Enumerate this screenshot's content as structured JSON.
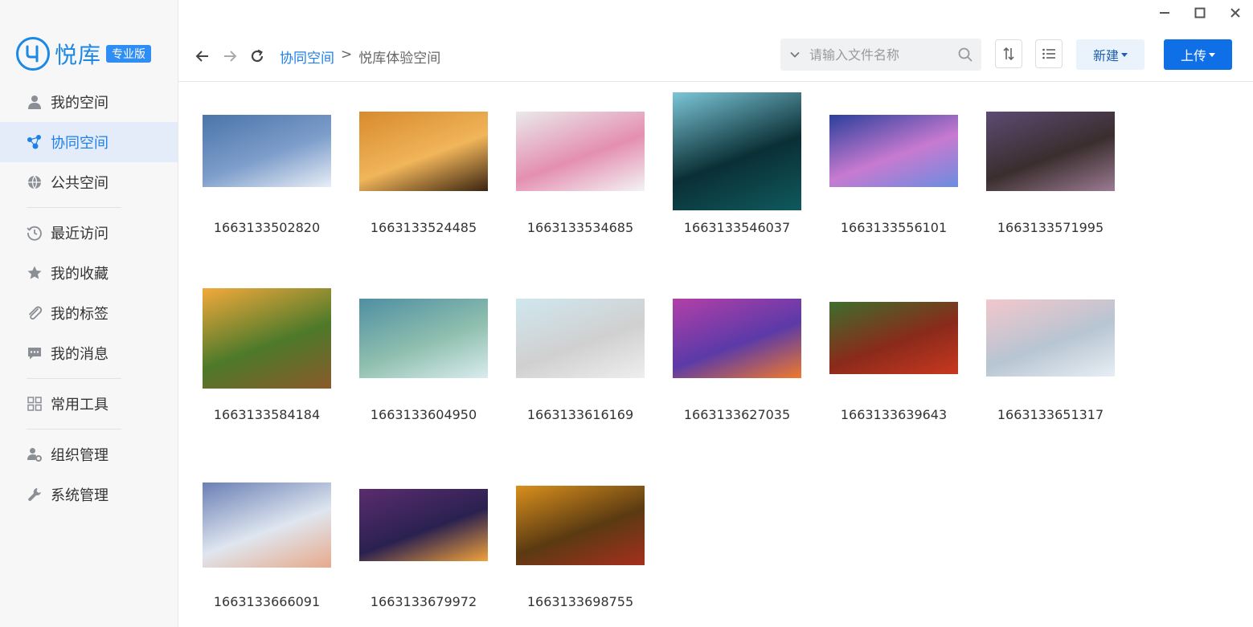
{
  "app": {
    "logo_text": "悦库",
    "logo_badge": "专业版"
  },
  "sidebar": {
    "items": [
      {
        "label": "我的空间",
        "icon": "user-icon",
        "active": false
      },
      {
        "label": "协同空间",
        "icon": "collaboration-icon",
        "active": true
      },
      {
        "label": "公共空间",
        "icon": "globe-icon",
        "active": false
      },
      {
        "label": "最近访问",
        "icon": "history-icon",
        "active": false
      },
      {
        "label": "我的收藏",
        "icon": "star-icon",
        "active": false
      },
      {
        "label": "我的标签",
        "icon": "paperclip-icon",
        "active": false
      },
      {
        "label": "我的消息",
        "icon": "message-icon",
        "active": false
      },
      {
        "label": "常用工具",
        "icon": "grid-icon",
        "active": false
      },
      {
        "label": "组织管理",
        "icon": "org-user-gear-icon",
        "active": false
      },
      {
        "label": "系统管理",
        "icon": "wrench-icon",
        "active": false
      }
    ]
  },
  "toolbar": {
    "breadcrumb_root": "协同空间",
    "breadcrumb_sep": ">",
    "breadcrumb_current": "悦库体验空间",
    "search_placeholder": "请输入文件名称",
    "new_label": "新建",
    "upload_label": "上传"
  },
  "files": [
    {
      "name": "1663133502820",
      "aspect": 0.5625,
      "colors": [
        "#4a74a8",
        "#e8eef6",
        "#7e9ecb"
      ]
    },
    {
      "name": "1663133524485",
      "aspect": 0.62,
      "colors": [
        "#d88a2e",
        "#3a2410",
        "#f1b55a"
      ]
    },
    {
      "name": "1663133534685",
      "aspect": 0.62,
      "colors": [
        "#e9e9eb",
        "#f3f3f4",
        "#e48fb0"
      ]
    },
    {
      "name": "1663133546037",
      "aspect": 0.92,
      "colors": [
        "#7cc6d8",
        "#0f5a5e",
        "#0a2f35"
      ]
    },
    {
      "name": "1663133556101",
      "aspect": 0.56,
      "colors": [
        "#2a3f9b",
        "#6b8de0",
        "#c77ad0"
      ]
    },
    {
      "name": "1663133571995",
      "aspect": 0.62,
      "colors": [
        "#5e4a73",
        "#9c7b93",
        "#3a2e2e"
      ]
    },
    {
      "name": "1663133584184",
      "aspect": 0.78,
      "colors": [
        "#f3a93c",
        "#8a5a2a",
        "#4d7a2a"
      ]
    },
    {
      "name": "1663133604950",
      "aspect": 0.62,
      "colors": [
        "#4f8fa3",
        "#d9ecee",
        "#8fbfae"
      ]
    },
    {
      "name": "1663133616169",
      "aspect": 0.62,
      "colors": [
        "#cfe7ef",
        "#eeeeee",
        "#d0d0d0"
      ]
    },
    {
      "name": "1663133627035",
      "aspect": 0.62,
      "colors": [
        "#b33fa8",
        "#f07a2c",
        "#5b3aa8"
      ]
    },
    {
      "name": "1663133639643",
      "aspect": 0.56,
      "colors": [
        "#3d6e2d",
        "#c8381f",
        "#8a2a1b"
      ]
    },
    {
      "name": "1663133651317",
      "aspect": 0.6,
      "colors": [
        "#f3c6cc",
        "#e8eef4",
        "#b7c5d2"
      ]
    },
    {
      "name": "1663133666091",
      "aspect": 0.66,
      "colors": [
        "#6a7fb5",
        "#e7a98b",
        "#dfe6ef"
      ]
    },
    {
      "name": "1663133679972",
      "aspect": 0.56,
      "colors": [
        "#5b2c6e",
        "#f2a23a",
        "#2a2150"
      ]
    },
    {
      "name": "1663133698755",
      "aspect": 0.62,
      "colors": [
        "#d9901d",
        "#a52f1e",
        "#5a3a12"
      ]
    }
  ]
}
